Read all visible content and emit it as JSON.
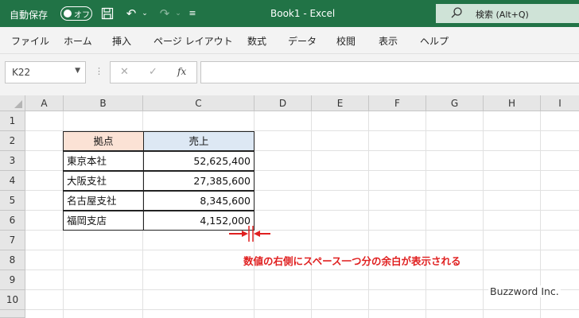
{
  "titlebar": {
    "autosave_label": "自動保存",
    "autosave_state": "オフ",
    "document_title": "Book1  -  Excel",
    "search_placeholder": "検索 (Alt+Q)",
    "icons": [
      "save-icon",
      "undo-icon",
      "redo-icon",
      "customize-icon"
    ]
  },
  "menu": {
    "items": [
      "ファイル",
      "ホーム",
      "挿入",
      "ページ レイアウト",
      "数式",
      "データ",
      "校閲",
      "表示",
      "ヘルプ"
    ]
  },
  "formula_bar": {
    "name_box": "K22",
    "formula": ""
  },
  "sheet": {
    "columns": [
      "A",
      "B",
      "C",
      "D",
      "E",
      "F",
      "G",
      "H",
      "I"
    ],
    "rows": [
      "1",
      "2",
      "3",
      "4",
      "5",
      "6",
      "7",
      "8",
      "9",
      "10"
    ]
  },
  "table": {
    "header_b": "拠点",
    "header_c": "売上",
    "rows": [
      {
        "b": "東京本社",
        "c": "52,625,400"
      },
      {
        "b": "大阪支社",
        "c": "27,385,600"
      },
      {
        "b": "名古屋支社",
        "c": "8,345,600"
      },
      {
        "b": "福岡支店",
        "c": "4,152,000"
      }
    ],
    "header_b_color": "#fbe2d5",
    "header_c_color": "#dde8f4"
  },
  "annotation": {
    "text": "数値の右側にスペース一つ分の余白が表示される",
    "color": "#e02020"
  },
  "watermark": "Buzzword Inc.",
  "accent_color": "#217346"
}
